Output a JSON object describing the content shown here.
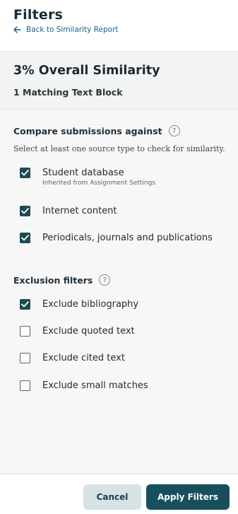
{
  "header": {
    "title": "Filters",
    "back_label": "Back to Similarity Report"
  },
  "summary": {
    "overall": "3% Overall Similarity",
    "matching": "1 Matching Text Block"
  },
  "compare": {
    "title": "Compare submissions against",
    "hint": "Select at least one source type to check for similarity.",
    "options": [
      {
        "label": "Student database",
        "sub": "Inherited from Assignment Settings",
        "checked": true
      },
      {
        "label": "Internet content",
        "checked": true
      },
      {
        "label": "Periodicals, journals and publications",
        "checked": true
      }
    ]
  },
  "exclusion": {
    "title": "Exclusion filters",
    "options": [
      {
        "label": "Exclude bibliography",
        "checked": true
      },
      {
        "label": "Exclude quoted text",
        "checked": false
      },
      {
        "label": "Exclude cited text",
        "checked": false
      },
      {
        "label": "Exclude small matches",
        "checked": false
      }
    ]
  },
  "footer": {
    "cancel_label": "Cancel",
    "apply_label": "Apply Filters"
  },
  "colors": {
    "accent": "#17505c",
    "link": "#1a5f8a",
    "checkbox": "#1d4a55"
  }
}
